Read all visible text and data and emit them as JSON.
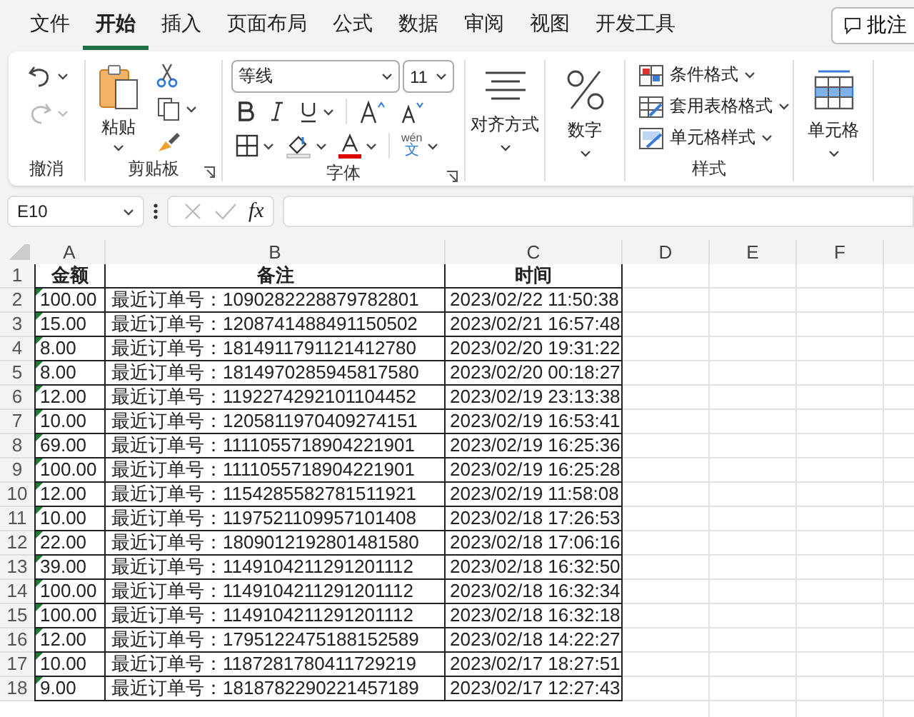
{
  "menu_tabs": [
    {
      "label": "文件",
      "selected": false
    },
    {
      "label": "开始",
      "selected": true
    },
    {
      "label": "插入",
      "selected": false
    },
    {
      "label": "页面布局",
      "selected": false
    },
    {
      "label": "公式",
      "selected": false
    },
    {
      "label": "数据",
      "selected": false
    },
    {
      "label": "审阅",
      "selected": false
    },
    {
      "label": "视图",
      "selected": false
    },
    {
      "label": "开发工具",
      "selected": false
    }
  ],
  "comment_button": "批注",
  "ribbon": {
    "groups": [
      {
        "kind": "undo",
        "label": "撤消",
        "buttons": [
          {
            "kind": "undo",
            "disabled": false
          },
          {
            "kind": "redo",
            "disabled": true
          }
        ]
      },
      {
        "kind": "clipboard",
        "label": "剪贴板",
        "paste_label": "粘贴",
        "launcher": true
      },
      {
        "kind": "font",
        "label": "字体",
        "font_name": "等线",
        "font_size": "11",
        "phonetic_ruby": "wén",
        "phonetic_base": "文",
        "launcher": true
      },
      {
        "kind": "alignment",
        "button_label": "对齐方式"
      },
      {
        "kind": "number",
        "button_label": "数字"
      },
      {
        "kind": "styles",
        "label": "样式",
        "items": [
          "条件格式",
          "套用表格格式",
          "单元格样式"
        ]
      },
      {
        "kind": "cells",
        "button_label": "单元格"
      }
    ]
  },
  "formula_bar": {
    "name_box": "E10",
    "fx": "fx"
  },
  "sheet": {
    "columns": [
      "A",
      "B",
      "C",
      "D",
      "E",
      "F"
    ],
    "rows": [
      {
        "number": "1",
        "kind": "header",
        "amount": "金额",
        "note": "备注",
        "time": "时间",
        "flag": false
      },
      {
        "number": "2",
        "kind": "data",
        "amount": "100.00",
        "note": "最近订单号：1090282228879782801",
        "time": "2023/02/22 11:50:38",
        "flag": true
      },
      {
        "number": "3",
        "kind": "data",
        "amount": "15.00",
        "note": "最近订单号：1208741488491150502",
        "time": "2023/02/21 16:57:48",
        "flag": true
      },
      {
        "number": "4",
        "kind": "data",
        "amount": "8.00",
        "note": "最近订单号：1814911791121412780",
        "time": "2023/02/20 19:31:22",
        "flag": true
      },
      {
        "number": "5",
        "kind": "data",
        "amount": "8.00",
        "note": "最近订单号：1814970285945817580",
        "time": "2023/02/20 00:18:27",
        "flag": true
      },
      {
        "number": "6",
        "kind": "data",
        "amount": "12.00",
        "note": "最近订单号：1192274292101104452",
        "time": "2023/02/19 23:13:38",
        "flag": true
      },
      {
        "number": "7",
        "kind": "data",
        "amount": "10.00",
        "note": "最近订单号：1205811970409274151",
        "time": "2023/02/19 16:53:41",
        "flag": true
      },
      {
        "number": "8",
        "kind": "data",
        "amount": "69.00",
        "note": "最近订单号：1111055718904221901",
        "time": "2023/02/19 16:25:36",
        "flag": true
      },
      {
        "number": "9",
        "kind": "data",
        "amount": "100.00",
        "note": "最近订单号：1111055718904221901",
        "time": "2023/02/19 16:25:28",
        "flag": true
      },
      {
        "number": "10",
        "kind": "data",
        "amount": "12.00",
        "note": "最近订单号：1154285582781511921",
        "time": "2023/02/19 11:58:08",
        "flag": true
      },
      {
        "number": "11",
        "kind": "data",
        "amount": "10.00",
        "note": "最近订单号：1197521109957101408",
        "time": "2023/02/18 17:26:53",
        "flag": true
      },
      {
        "number": "12",
        "kind": "data",
        "amount": "22.00",
        "note": "最近订单号：1809012192801481580",
        "time": "2023/02/18 17:06:16",
        "flag": true
      },
      {
        "number": "13",
        "kind": "data",
        "amount": "39.00",
        "note": "最近订单号：1149104211291201112",
        "time": "2023/02/18 16:32:50",
        "flag": true
      },
      {
        "number": "14",
        "kind": "data",
        "amount": "100.00",
        "note": "最近订单号：1149104211291201112",
        "time": "2023/02/18 16:32:34",
        "flag": true
      },
      {
        "number": "15",
        "kind": "data",
        "amount": "100.00",
        "note": "最近订单号：1149104211291201112",
        "time": "2023/02/18 16:32:18",
        "flag": true
      },
      {
        "number": "16",
        "kind": "data",
        "amount": "12.00",
        "note": "最近订单号：1795122475188152589",
        "time": "2023/02/18 14:22:27",
        "flag": true
      },
      {
        "number": "17",
        "kind": "data",
        "amount": "10.00",
        "note": "最近订单号：1187281780411729219",
        "time": "2023/02/17 18:27:51",
        "flag": true
      },
      {
        "number": "18",
        "kind": "data",
        "amount": "9.00",
        "note": "最近订单号：1818782290221457189",
        "time": "2023/02/17 12:27:43",
        "flag": true
      }
    ]
  }
}
